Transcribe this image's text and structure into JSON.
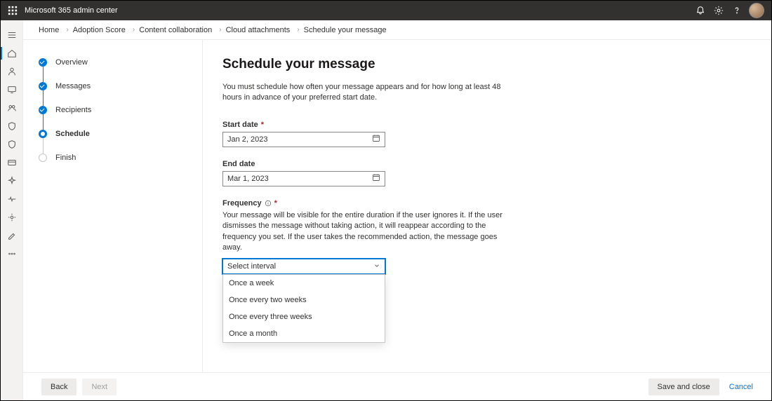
{
  "header": {
    "app_title": "Microsoft 365 admin center"
  },
  "breadcrumb": {
    "items": [
      "Home",
      "Adoption Score",
      "Content collaboration",
      "Cloud attachments",
      "Schedule your message"
    ]
  },
  "steps": {
    "items": [
      {
        "label": "Overview",
        "state": "done"
      },
      {
        "label": "Messages",
        "state": "done"
      },
      {
        "label": "Recipients",
        "state": "done"
      },
      {
        "label": "Schedule",
        "state": "current"
      },
      {
        "label": "Finish",
        "state": "future"
      }
    ]
  },
  "form": {
    "title": "Schedule your message",
    "description": "You must schedule how often your message appears and for how long at least 48 hours in advance of your preferred start date.",
    "start_date": {
      "label": "Start date",
      "value": "Jan 2, 2023",
      "required": true
    },
    "end_date": {
      "label": "End date",
      "value": "Mar 1, 2023",
      "required": false
    },
    "frequency": {
      "label": "Frequency",
      "required": true,
      "help": "Your message will be visible for the entire duration if the user ignores it. If the user dismisses the message without taking action, it will reappear according to the frequency you set. If the user takes the recommended action, the message goes away.",
      "placeholder": "Select interval",
      "options": [
        "Once a week",
        "Once every two weeks",
        "Once every three weeks",
        "Once a month"
      ]
    }
  },
  "footer": {
    "back": "Back",
    "next": "Next",
    "save": "Save and close",
    "cancel": "Cancel"
  }
}
